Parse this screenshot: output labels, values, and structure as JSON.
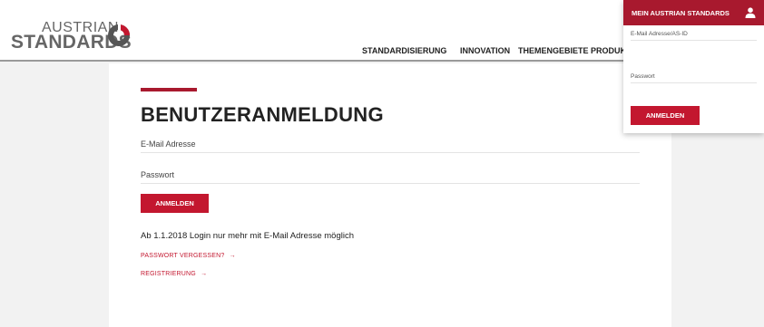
{
  "logo": {
    "line1": "AUSTRIAN",
    "line2": "STANDARDS"
  },
  "nav": {
    "items": [
      "STANDARDISIERUNG",
      "INNOVATION",
      "THEMENGEBIETE",
      "PRODUKTE"
    ]
  },
  "login": {
    "title": "BENUTZERANMELDUNG",
    "email_placeholder": "E-Mail Adresse",
    "password_placeholder": "Passwort",
    "submit_label": "ANMELDEN",
    "info": "Ab 1.1.2018 Login nur mehr mit E-Mail Adresse möglich",
    "forgot_link": "PASSWORT VERGESSEN?",
    "register_link": "REGISTRIERUNG",
    "arrow": "→"
  },
  "panel": {
    "title": "MEIN AUSTRIAN STANDARDS",
    "email_placeholder": "E-Mail Adresse/AS-ID",
    "password_placeholder": "Passwort",
    "submit_label": "ANMELDEN"
  },
  "colors": {
    "brand_red": "#c3172f",
    "dark_red": "#a8192e"
  }
}
